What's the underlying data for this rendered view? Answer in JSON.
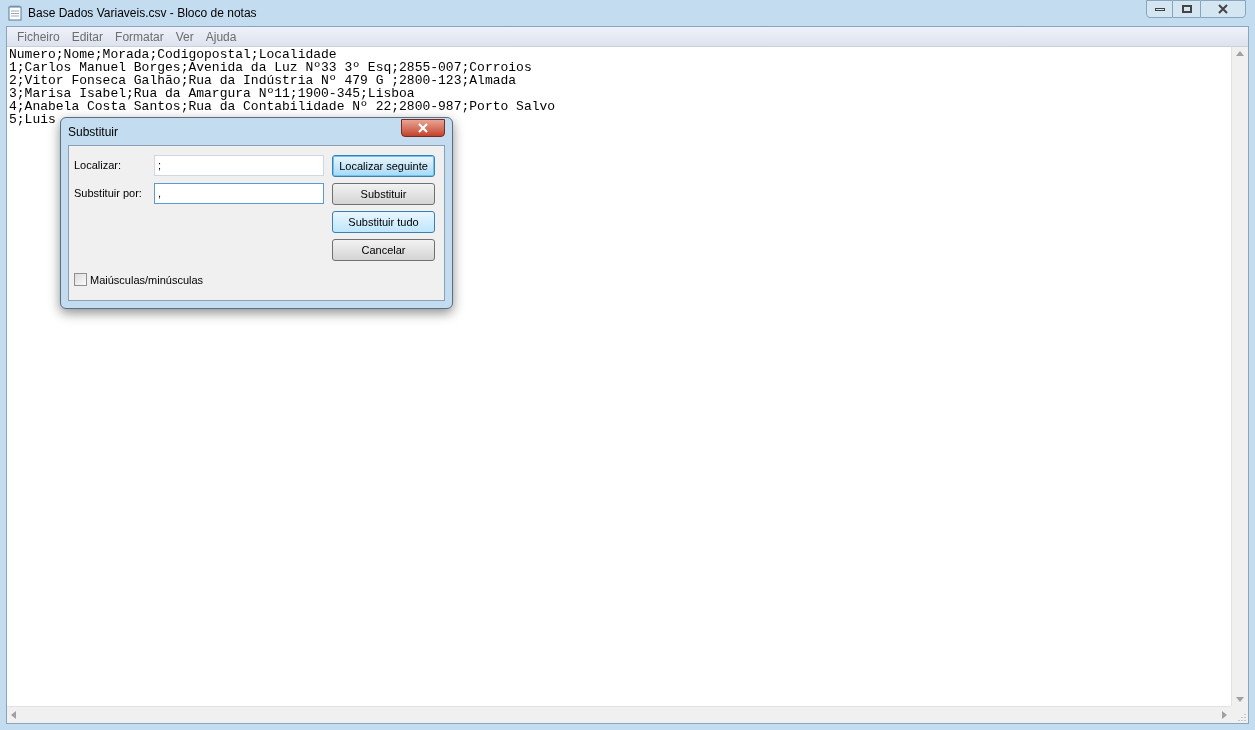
{
  "window": {
    "title": "Base Dados Variaveis.csv - Bloco de notas"
  },
  "menu": [
    "Ficheiro",
    "Editar",
    "Formatar",
    "Ver",
    "Ajuda"
  ],
  "lines": [
    "Numero;Nome;Morada;Codigopostal;Localidade",
    "1;Carlos Manuel Borges;Avenida da Luz Nº33 3º Esq;2855-007;Corroios",
    "2;Vitor Fonseca Galhão;Rua da Indústria Nº 479 G ;2800-123;Almada",
    "3;Marisa Isabel;Rua da Amargura Nº11;1900-345;Lisboa",
    "4;Anabela Costa Santos;Rua da Contabilidade Nº 22;2800-987;Porto Salvo",
    "5;Luis"
  ],
  "dialog": {
    "title": "Substituir",
    "fields": [
      {
        "label": "Localizar:",
        "value": ";"
      },
      {
        "label": "Substituir por:",
        "value": ","
      }
    ],
    "buttons": [
      {
        "label": "Localizar seguinte",
        "selected": true,
        "hovered": false
      },
      {
        "label": "Substituir",
        "selected": false,
        "hovered": false
      },
      {
        "label": "Substituir tudo",
        "selected": false,
        "hovered": true
      },
      {
        "label": "Cancelar",
        "selected": false,
        "hovered": false
      }
    ],
    "checkbox": {
      "label": "Maiúsculas/minúsculas",
      "checked": false
    }
  }
}
